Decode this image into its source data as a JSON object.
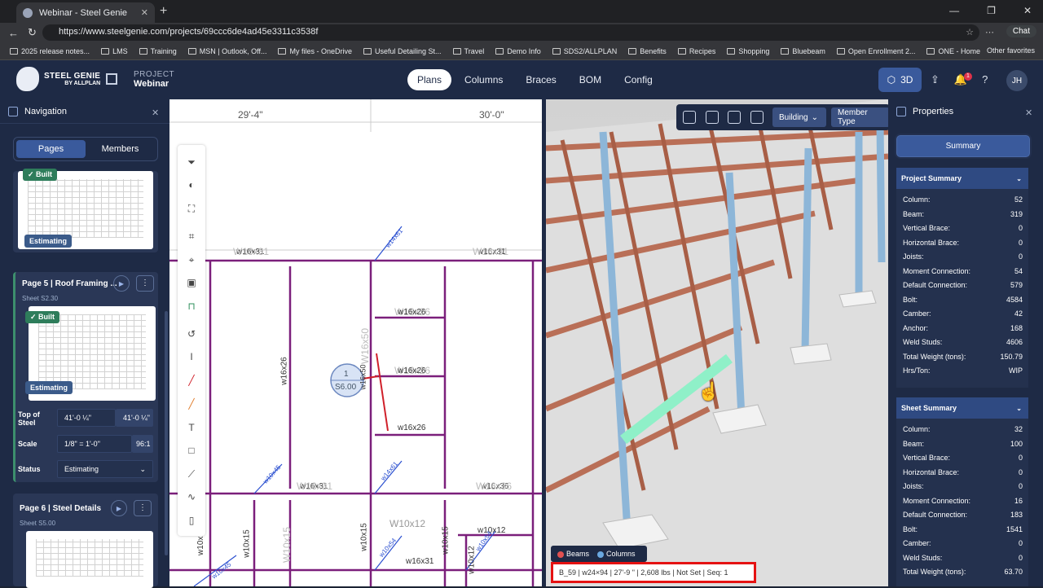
{
  "browser": {
    "tab_title": "Webinar - Steel Genie",
    "url": "https://www.steelgenie.com/projects/69ccc6de4ad45e3311c3538f",
    "chat_label": "Chat",
    "bookmarks": [
      "2025 release notes...",
      "LMS",
      "Training",
      "MSN | Outlook, Off...",
      "My files - OneDrive",
      "Useful Detailing St...",
      "Travel",
      "Demo Info",
      "SDS2/ALLPLAN",
      "Benefits",
      "Recipes",
      "Shopping",
      "Bluebeam",
      "Open Enrollment 2...",
      "ONE - Home"
    ],
    "other_favorites": "Other favorites"
  },
  "app": {
    "logo_line1": "STEEL GENIE",
    "logo_line2": "BY ALLPLAN",
    "project_label": "PROJECT",
    "project_name": "Webinar",
    "tabs": [
      "Plans",
      "Columns",
      "Braces",
      "BOM",
      "Config"
    ],
    "active_tab": "Plans",
    "btn_3d": "3D",
    "notification_count": "1",
    "avatar": "JH"
  },
  "navigation": {
    "title": "Navigation",
    "segments": [
      "Pages",
      "Members"
    ],
    "built_label": "✓ Built",
    "estimating_label": "Estimating",
    "page5_title": "Page 5 | Roof Framing ...",
    "page5_sheet": "Sheet S2.30",
    "top_of_steel_label": "Top of Steel",
    "top_of_steel_value": "41'-0 ¼\"",
    "top_of_steel_value2": "41'-0 ¼\"",
    "scale_label": "Scale",
    "scale_value": "1/8\" = 1'-0\"",
    "scale_ratio": "96:1",
    "status_label": "Status",
    "status_value": "Estimating",
    "page6_title": "Page 6 | Steel Details",
    "page6_sheet": "Sheet S5.00"
  },
  "plan": {
    "dims": [
      "29'-4\"",
      "30'-0\""
    ],
    "labels": [
      "w16x31",
      "W16x31",
      "w16x31",
      "W16x31",
      "w14x61",
      "W16x26",
      "w16x26",
      "W16x26",
      "w16x26",
      "w16x26",
      "W16x50",
      "w16x26",
      "w16x50",
      "w16x31",
      "W16x31",
      "w16x36",
      "W16x36",
      "w10x45",
      "w14x61",
      "W10x12",
      "w10x12",
      "w10x12",
      "w10x15",
      "W10x15",
      "w10x15",
      "w10x15",
      "w10x54",
      "w10x54",
      "w16x31",
      "w10x45",
      "w10x1",
      "1",
      "S6.00"
    ]
  },
  "view3d": {
    "building_label": "Building",
    "member_type_label": "Member Type",
    "legend_beams": "Beams",
    "legend_columns": "Columns",
    "status_line": "B_59 | w24×94 | 27'-9 \" | 2,608 lbs | Not Set | Seq: 1",
    "beam_color": "#b86a50",
    "column_color": "#8db6d8",
    "selected_color": "#8ff0c8"
  },
  "properties": {
    "title": "Properties",
    "summary_button": "Summary",
    "project_summary_title": "Project Summary",
    "project_summary": [
      {
        "k": "Column:",
        "v": "52"
      },
      {
        "k": "Beam:",
        "v": "319"
      },
      {
        "k": "Vertical Brace:",
        "v": "0"
      },
      {
        "k": "Horizontal Brace:",
        "v": "0"
      },
      {
        "k": "Joists:",
        "v": "0"
      },
      {
        "k": "Moment Connection:",
        "v": "54"
      },
      {
        "k": "Default Connection:",
        "v": "579"
      },
      {
        "k": "Bolt:",
        "v": "4584"
      },
      {
        "k": "Camber:",
        "v": "42"
      },
      {
        "k": "Anchor:",
        "v": "168"
      },
      {
        "k": "Weld Studs:",
        "v": "4606"
      },
      {
        "k": "Total Weight (tons):",
        "v": "150.79"
      },
      {
        "k": "Hrs/Ton:",
        "v": "WIP"
      }
    ],
    "sheet_summary_title": "Sheet Summary",
    "sheet_summary": [
      {
        "k": "Column:",
        "v": "32"
      },
      {
        "k": "Beam:",
        "v": "100"
      },
      {
        "k": "Vertical Brace:",
        "v": "0"
      },
      {
        "k": "Horizontal Brace:",
        "v": "0"
      },
      {
        "k": "Joists:",
        "v": "0"
      },
      {
        "k": "Moment Connection:",
        "v": "16"
      },
      {
        "k": "Default Connection:",
        "v": "183"
      },
      {
        "k": "Bolt:",
        "v": "1541"
      },
      {
        "k": "Camber:",
        "v": "0"
      },
      {
        "k": "Weld Studs:",
        "v": "0"
      },
      {
        "k": "Total Weight (tons):",
        "v": "63.70"
      }
    ]
  }
}
